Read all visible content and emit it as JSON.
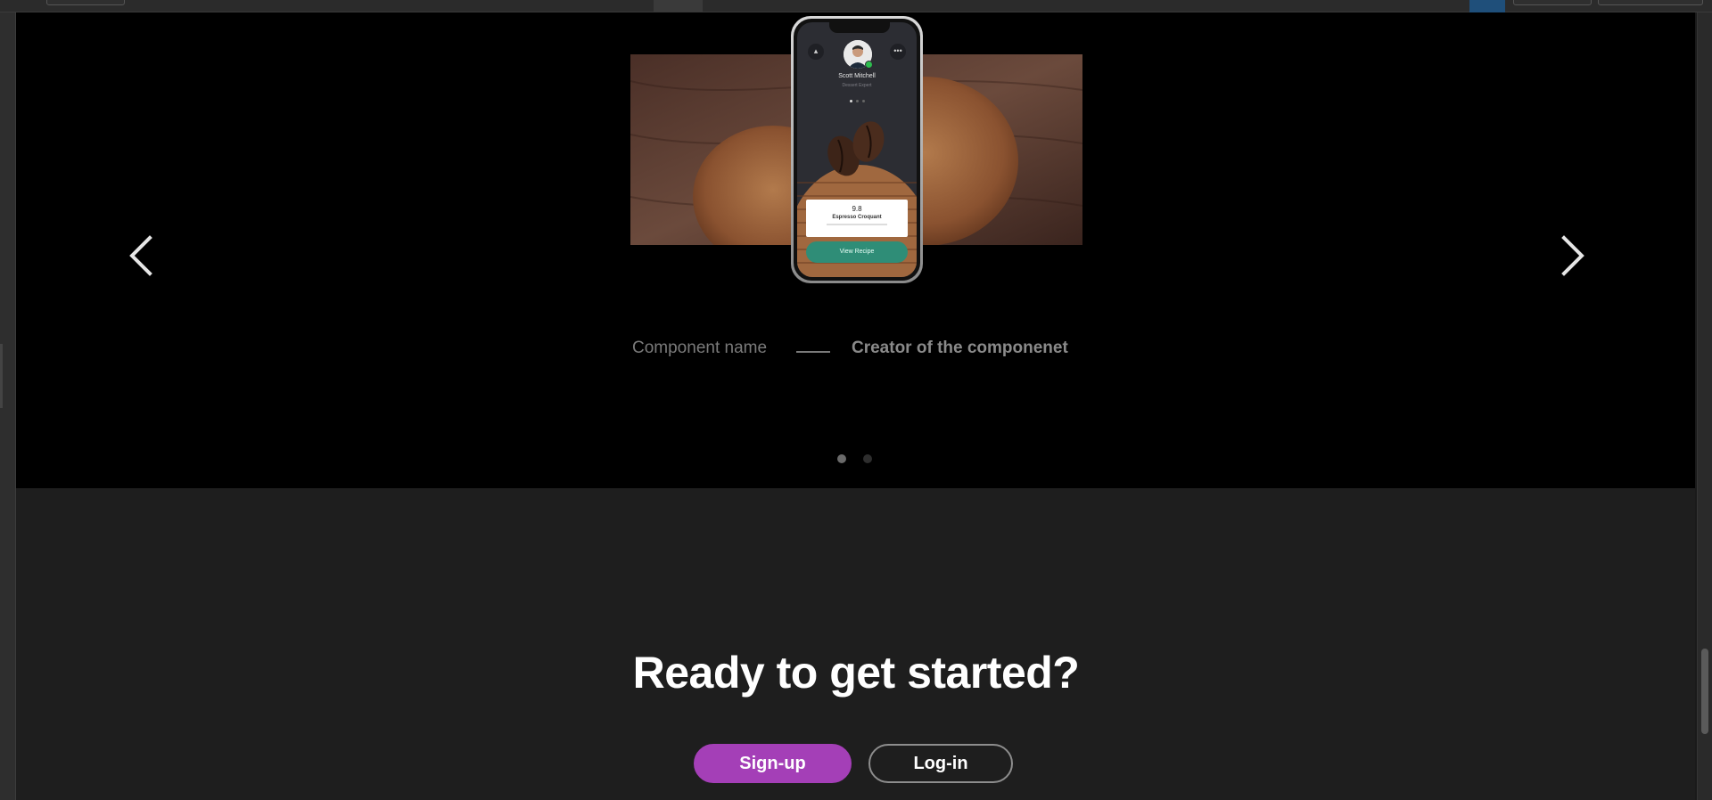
{
  "hero": {
    "prev_icon": "chevron-left-icon",
    "next_icon": "chevron-right-icon",
    "phone": {
      "profile_name": "Scott Mitchell",
      "profile_role": "Dessert Expert",
      "rating": "9.8",
      "dish_name": "Espresso Croquant",
      "button_label": "View Recipe",
      "left_icon": "info-icon",
      "right_icon": "more-icon"
    },
    "caption": {
      "component_name": "Component name",
      "creator": "Creator of the componenet"
    },
    "pagination": {
      "total": 2,
      "active": 1
    }
  },
  "cta": {
    "title": "Ready to get started?",
    "signup_label": "Sign-up",
    "login_label": "Log-in"
  },
  "colors": {
    "hero_background": "#000000",
    "section_background": "#1e1e1e",
    "signup_accent": "#a43fb7",
    "phone_cta": "#2f8d77"
  }
}
